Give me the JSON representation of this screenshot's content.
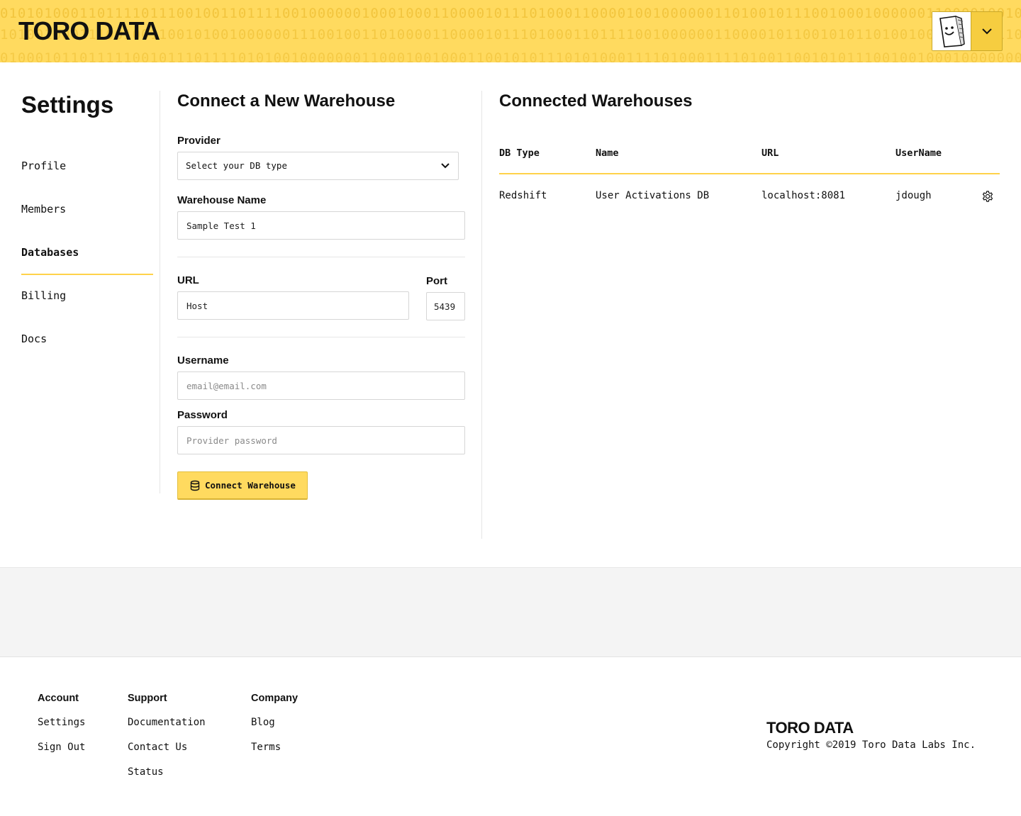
{
  "header": {
    "logo": "TORO DATA",
    "binary_rows": [
      "01010100011011110111001001101111001000000100010001100001011101000110000100100000011010010111001000100000011000010010000001110011",
      "10100100011100100110010100100000011100100110100001100001011101000110111100100000011000010110010101101001001000000110010001100001",
      "01000101101111100101110111101010010000000110001001000110010101110101000111101000111101001100101011100100100010000000110110101011"
    ]
  },
  "settings": {
    "title": "Settings",
    "nav": [
      {
        "label": "Profile",
        "active": false
      },
      {
        "label": "Members",
        "active": false
      },
      {
        "label": "Databases",
        "active": true
      },
      {
        "label": "Billing",
        "active": false
      },
      {
        "label": "Docs",
        "active": false
      }
    ]
  },
  "form": {
    "title": "Connect a New Warehouse",
    "provider_label": "Provider",
    "provider_value": "Select your DB type",
    "warehouse_name_label": "Warehouse Name",
    "warehouse_name_value": "Sample Test 1",
    "url_label": "URL",
    "url_value": "Host",
    "port_label": "Port",
    "port_value": "5439",
    "username_label": "Username",
    "username_placeholder": "email@email.com",
    "password_label": "Password",
    "password_placeholder": "Provider password",
    "submit_label": "Connect Warehouse"
  },
  "warehouses": {
    "title": "Connected Warehouses",
    "columns": [
      "DB Type",
      "Name",
      "URL",
      "UserName"
    ],
    "rows": [
      {
        "db_type": "Redshift",
        "name": "User Activations DB",
        "url": "localhost:8081",
        "username": "jdough"
      }
    ]
  },
  "footer": {
    "account": {
      "heading": "Account",
      "links": [
        "Settings",
        "Sign Out"
      ]
    },
    "support": {
      "heading": "Support",
      "links": [
        "Documentation",
        "Contact Us",
        "Status"
      ]
    },
    "company": {
      "heading": "Company",
      "links": [
        "Blog",
        "Terms"
      ]
    },
    "logo": "TORO DATA",
    "copyright": "Copyright ©2019 Toro Data Labs Inc."
  },
  "colors": {
    "accent": "#ffda5f",
    "accent_border": "#ffd24a"
  }
}
